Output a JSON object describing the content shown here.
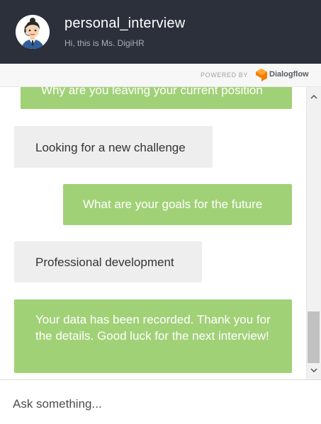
{
  "header": {
    "title": "personal_interview",
    "subtitle": "Hi, this is Ms. DigiHR",
    "avatar_icon": "businesswoman-avatar-icon"
  },
  "powered_bar": {
    "label": "POWERED BY",
    "brand": "Dialogflow",
    "brand_icon": "dialogflow-logo-icon",
    "brand_color": "#f57c00"
  },
  "messages": [
    {
      "sender": "bot",
      "text": "Why are you leaving your current position"
    },
    {
      "sender": "user",
      "text": "Looking for a new challenge"
    },
    {
      "sender": "bot",
      "text": "What are your goals for the future"
    },
    {
      "sender": "user",
      "text": "Professional development"
    },
    {
      "sender": "bot",
      "text": "Your data has been recorded. Thank you for the details. Good luck for the next interview!"
    }
  ],
  "scrollbar": {
    "up_icon": "chevron-up-icon",
    "down_icon": "chevron-down-icon"
  },
  "input": {
    "placeholder": "Ask something...",
    "value": ""
  },
  "colors": {
    "header_bg": "#2b303b",
    "bot_bubble": "#a1d177",
    "user_bubble": "#eeeeee"
  }
}
